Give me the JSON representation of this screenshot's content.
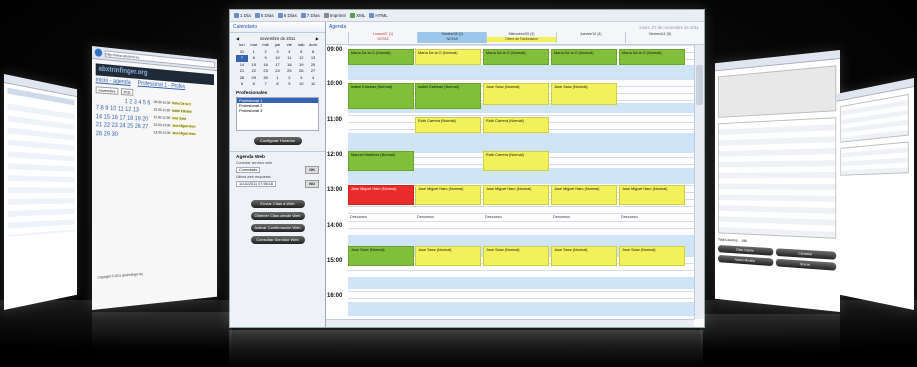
{
  "main": {
    "toolbar": [
      {
        "label": "1 Día"
      },
      {
        "label": "5 Días"
      },
      {
        "label": "6 Días"
      },
      {
        "label": "7 Días"
      },
      {
        "label": "Imprimir"
      },
      {
        "label": "XML"
      },
      {
        "label": "HTML"
      }
    ],
    "left_panel": {
      "calendar_title": "Calendario",
      "month_label": "noviembre de 2011",
      "weekdays": [
        "lun",
        "mar",
        "mié",
        "jue",
        "vie",
        "sáb",
        "dom"
      ],
      "days": [
        "31",
        "1",
        "2",
        "3",
        "4",
        "5",
        "6",
        "7",
        "8",
        "9",
        "10",
        "11",
        "12",
        "13",
        "14",
        "15",
        "16",
        "17",
        "18",
        "19",
        "20",
        "21",
        "22",
        "23",
        "24",
        "25",
        "26",
        "27",
        "28",
        "29",
        "30",
        "1",
        "2",
        "3",
        "4",
        "5",
        "6",
        "7",
        "8",
        "9",
        "10",
        "11"
      ],
      "selected_day": "7",
      "profesionales_title": "Profesionales",
      "profesionales": [
        "Profesional 1",
        "Profesional 2",
        "Profesional 3"
      ],
      "configure_button": "Configurar Horarios",
      "agenda_web_title": "Agenda Web",
      "conn_label": "Conectar servidor web",
      "conn_value": "Conectado",
      "conn_button": "OK",
      "sync_label": "Última web respuesta",
      "sync_value": "11/11/2011 07:56:16",
      "sync_button": "NO",
      "pill_buttons": [
        "Enviar Citas a Web",
        "Obtener Citas desde Web",
        "Activar Confirmación Web",
        "Consultar Servidor Web"
      ]
    },
    "agenda": {
      "title": "Agenda",
      "date": "lunes, 07 de noviembre de 2011",
      "columns": [
        "Lunes/07 (1)",
        "Martes/08 (2)",
        "Miércoles/09 (3)",
        "Jueves/10 (4)",
        "Viernes/11 (5)"
      ],
      "notes_label": "NOTAS",
      "hours": [
        "09:00",
        "10:00",
        "11:00",
        "12:00",
        "13:00",
        "14:00",
        "15:00",
        "16:00"
      ],
      "events": {
        "e1": "Cierre de Facturación",
        "e2": "María De la O (Normal)",
        "e3": "María De la O (Normal)",
        "e4": "María De la O (Normal)",
        "e5": "María De la O (Normal)",
        "e6": "María De la O (Normal)",
        "e7": "Isabel Esteban (Normal)",
        "e8": "Isabel Esteban (Normal)",
        "e9": "Jose Sanz (Normal)",
        "e10": "Jose Sanz (Normal)",
        "e11": "Ruth Carrera (Normal)",
        "e12": "Ruth Carrera (Normal)",
        "e13": "Manuel Martínez (Normal)",
        "e14": "Ruth Carrera (Normal)",
        "e15": "Jose Miguel Haro (Normal)",
        "e16": "Jose Miguel Haro (Normal)",
        "e17": "Jose Miguel Haro (Normal)",
        "e18": "Jose Miguel Haro (Normal)",
        "e19": "Jose Miguel Haro (Normal)",
        "e20": "Descanso",
        "e21": "Descanso",
        "e22": "Descanso",
        "e23": "Descanso",
        "e24": "Descanso",
        "e25": "Jose Sanz (Normal)",
        "e26": "Jose Sanz (Normal)",
        "e27": "Jose Sanz (Normal)",
        "e28": "Jose Sanz (Normal)",
        "e29": "Jose Sanz (Normal)"
      }
    }
  },
  "left_browser": {
    "url_bar": "http://www.abxtrinf.es",
    "site_logo": "abxtrinfinger.org",
    "nav_links": "inicio - agenda",
    "profesional_label": "Profesional 1 - Profes",
    "month_select": "noviembre",
    "year_select": "2011",
    "cal_rows": [
      "1 2 3 4 5 6",
      "7 8 9 10 11 12 13",
      "14 15 16 17 18 19 20",
      "21 22 23 24 25 26 27",
      "28 29 30"
    ],
    "selected_day": "7",
    "slots": [
      {
        "time": "09:30-10:30",
        "name": "María De la O"
      },
      {
        "time": "10:30-11:30",
        "name": "Isabel Esteban"
      },
      {
        "time": "11:30-12:30",
        "name": "Jose Sanz"
      },
      {
        "time": "12:30-13:30",
        "name": "Jose Miguel Haro"
      },
      {
        "time": "13:30-14:30",
        "name": "Jose Miguel Haro"
      }
    ],
    "footer": "Copyright © 2011 abxtrinfinger.org"
  },
  "right_window": {
    "buttons": [
      "Citas Cliente",
      "Cancelar",
      "Nuevo Modelo",
      "Borrar"
    ],
    "total_label": "Total Columns:",
    "total_value": "188"
  },
  "colors": {
    "event_green": "#7fbf3a",
    "event_yellow": "#f3f15a",
    "event_red": "#ea2b2b",
    "accent_blue": "#3363b4",
    "slot_blue": "#cfe4f7"
  }
}
